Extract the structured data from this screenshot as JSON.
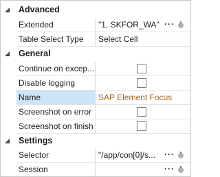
{
  "categories": [
    {
      "label": "Advanced",
      "properties": [
        {
          "name": "Extended",
          "value": "\"1, SKFOR_WA\"",
          "kind": "text-ellipsis"
        },
        {
          "name": "Table Select Type",
          "value": "Select Cell",
          "kind": "text"
        }
      ]
    },
    {
      "label": "General",
      "properties": [
        {
          "name": "Continue on excep...",
          "value": "",
          "kind": "checkbox",
          "checked": false
        },
        {
          "name": "Disable logging",
          "value": "",
          "kind": "checkbox",
          "checked": false
        },
        {
          "name": "Name",
          "value": "SAP Element Focus",
          "kind": "text",
          "selected": true
        },
        {
          "name": "Screenshot on error",
          "value": "",
          "kind": "checkbox",
          "checked": false
        },
        {
          "name": "Screenshot on finish",
          "value": "",
          "kind": "checkbox",
          "checked": false
        }
      ]
    },
    {
      "label": "Settings",
      "properties": [
        {
          "name": "Selector",
          "value": "\"/app/con[0]/s...",
          "kind": "text-ellipsis"
        },
        {
          "name": "Session",
          "value": "",
          "kind": "text-ellipsis"
        }
      ]
    }
  ],
  "ellipsis_label": "···",
  "colors": {
    "selected_row": "#cce4f7",
    "selected_value_text": "#9a6a2c",
    "grid_line": "#e3e3e3"
  },
  "icons": {
    "collapse": "triangle-down-icon",
    "value_button": "circle-icon"
  }
}
